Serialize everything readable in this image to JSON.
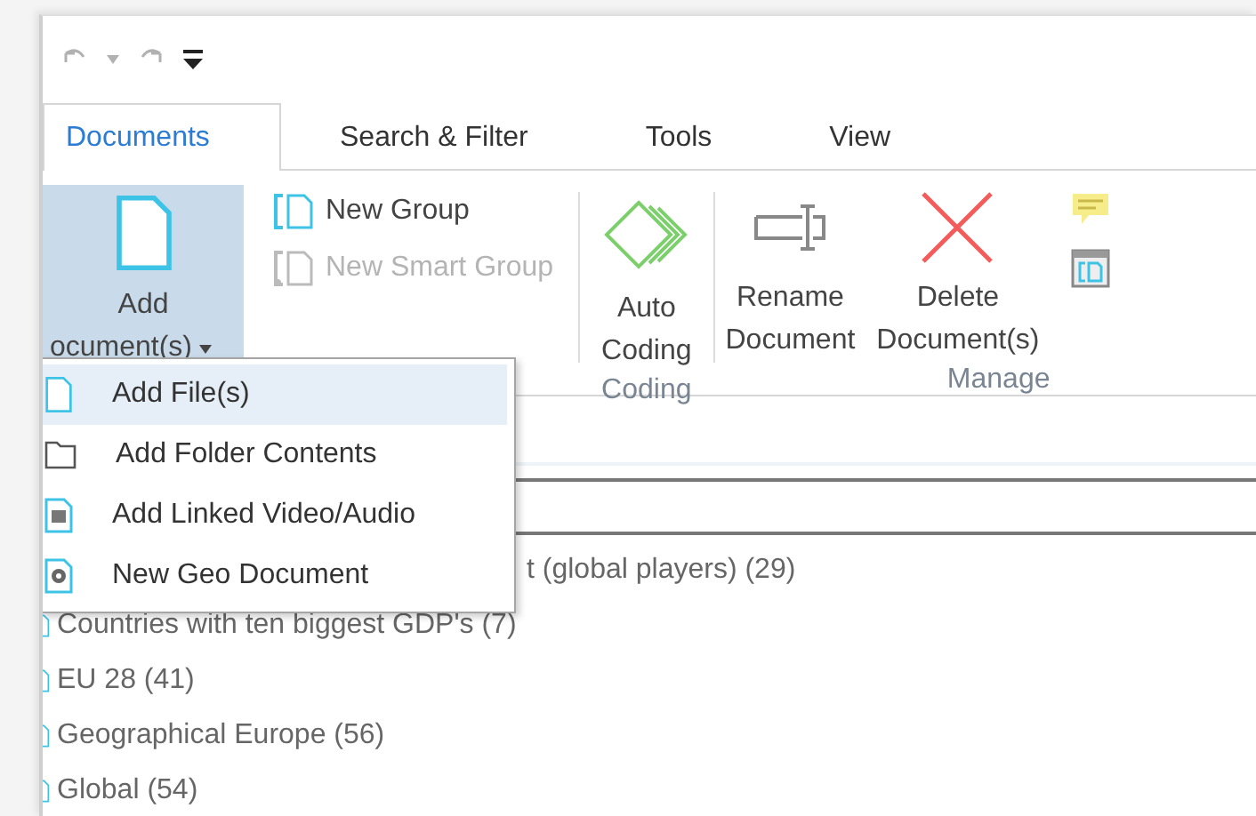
{
  "quick_access": [
    {
      "kind": "undo",
      "disabled": true
    },
    {
      "kind": "dropdown",
      "disabled": true
    },
    {
      "kind": "redo",
      "disabled": true
    },
    {
      "kind": "customize",
      "disabled": false
    }
  ],
  "tabs": [
    {
      "label": "Documents",
      "selected": true
    },
    {
      "label": "Search & Filter",
      "selected": false
    },
    {
      "label": "Tools",
      "selected": false
    },
    {
      "label": "View",
      "selected": false
    }
  ],
  "ribbon": {
    "add_button": {
      "lines": [
        "Add",
        "ocument(s)"
      ],
      "pressed": true
    },
    "small_buttons": [
      {
        "label": "New Group",
        "disabled": false
      },
      {
        "label": "New Smart Group",
        "disabled": true
      }
    ],
    "coding_group": {
      "button_lines": [
        "Auto",
        "Coding"
      ],
      "label": "Coding"
    },
    "manage_group": {
      "buttons": [
        {
          "lines": [
            "Rename",
            "Document"
          ]
        },
        {
          "lines": [
            "Delete",
            "Document(s)"
          ]
        }
      ],
      "label": "Manage"
    }
  },
  "dropdown_menu": [
    {
      "label": "Add File(s)",
      "selected": true
    },
    {
      "label": "Add Folder Contents",
      "selected": false
    },
    {
      "label": "Add Linked Video/Audio",
      "selected": false
    },
    {
      "label": "New Geo Document",
      "selected": false
    }
  ],
  "document_groups": [
    {
      "label": "t (global players) (29)"
    },
    {
      "label": "Countries with ten biggest GDP's (7)"
    },
    {
      "label": "EU 28 (41)"
    },
    {
      "label": "Geographical Europe (56)"
    },
    {
      "label": "Global (54)"
    }
  ]
}
